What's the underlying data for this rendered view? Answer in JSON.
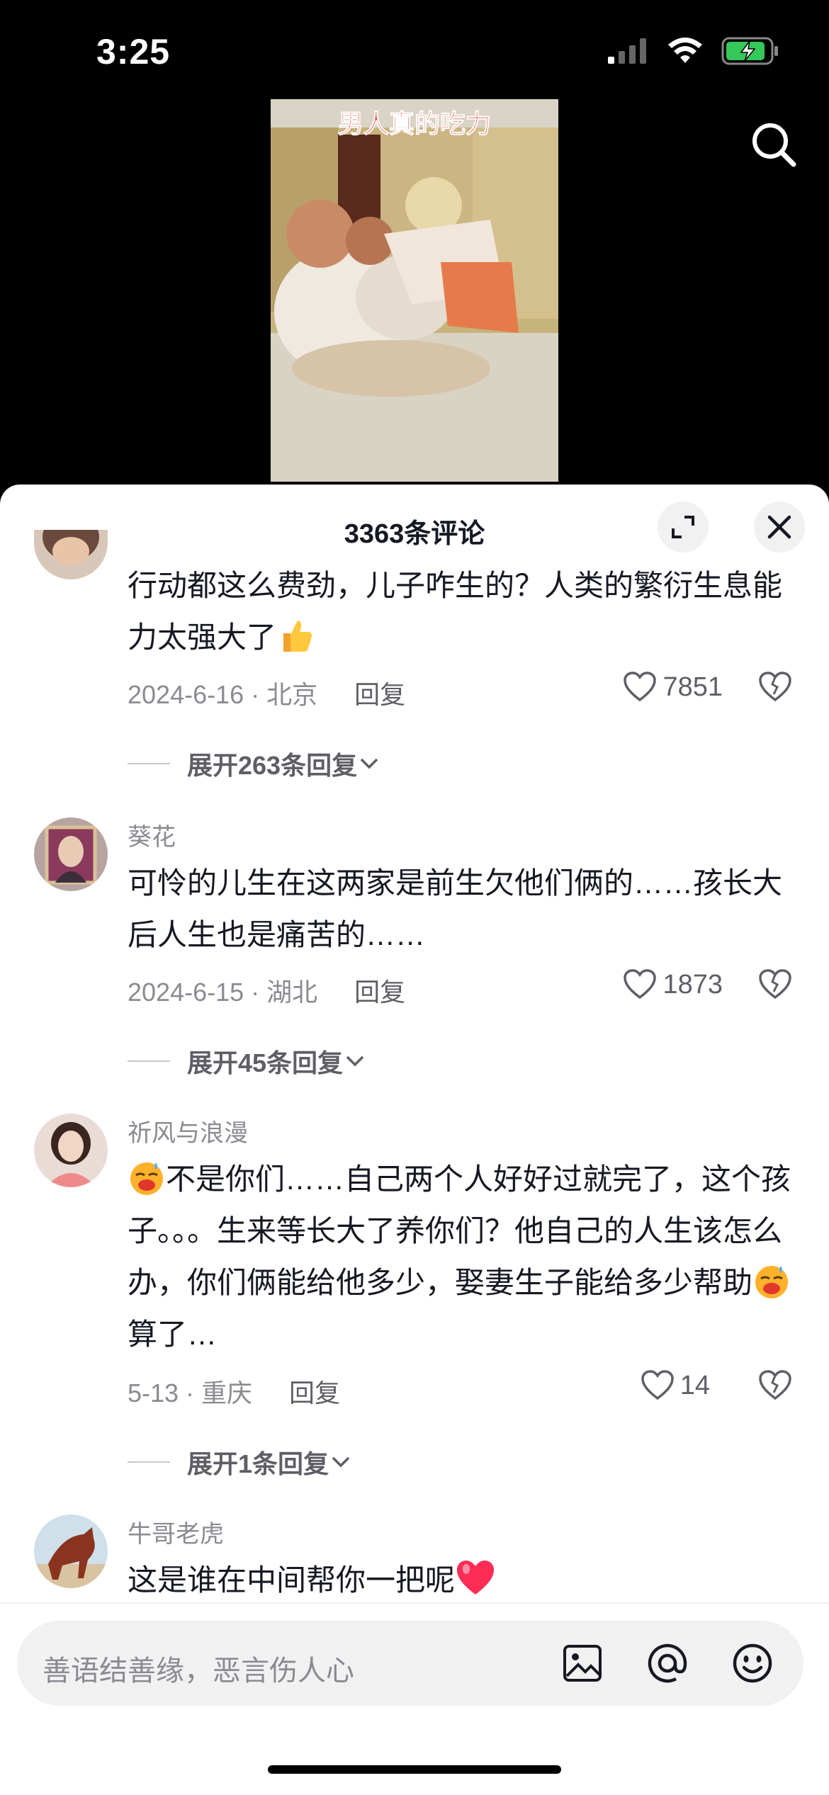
{
  "status": {
    "time": "3:25"
  },
  "video": {
    "overlay_title": "男人真的吃力"
  },
  "sheet": {
    "title": "3363条评论"
  },
  "comments": [
    {
      "user": "",
      "text": "行动都这么费劲，儿子咋生的？人类的繁衍生息能力太强大了",
      "text_suffix_emoji": "thumbs-up",
      "date_location": "2024-6-16 · 北京",
      "reply_label": "回复",
      "likes": "7851",
      "expand_label": "展开263条回复"
    },
    {
      "user": "葵花",
      "text": "可怜的儿生在这两家是前生欠他们俩的……孩长大后人生也是痛苦的……",
      "date_location": "2024-6-15 · 湖北",
      "reply_label": "回复",
      "likes": "1873",
      "expand_label": "展开45条回复"
    },
    {
      "user": "祈风与浪漫",
      "text_part1": "不是你们……自己两个人好好过就完了，这个孩子。。。生来等长大了养你们？他自己的人生该怎么办，你们俩能给他多少，娶妻生子能给多少帮助",
      "text_part2": "算了…",
      "date_location": "5-13 · 重庆",
      "reply_label": "回复",
      "likes": "14",
      "expand_label": "展开1条回复"
    },
    {
      "user": "牛哥老虎",
      "text": "这是谁在中间帮你一把呢",
      "text_suffix_emoji": "red-heart"
    }
  ],
  "input": {
    "placeholder": "善语结善缘，恶言伤人心"
  },
  "colors": {
    "accent_red": "#ff3b30",
    "text_primary": "#161823",
    "text_secondary": "#8a8b91"
  }
}
